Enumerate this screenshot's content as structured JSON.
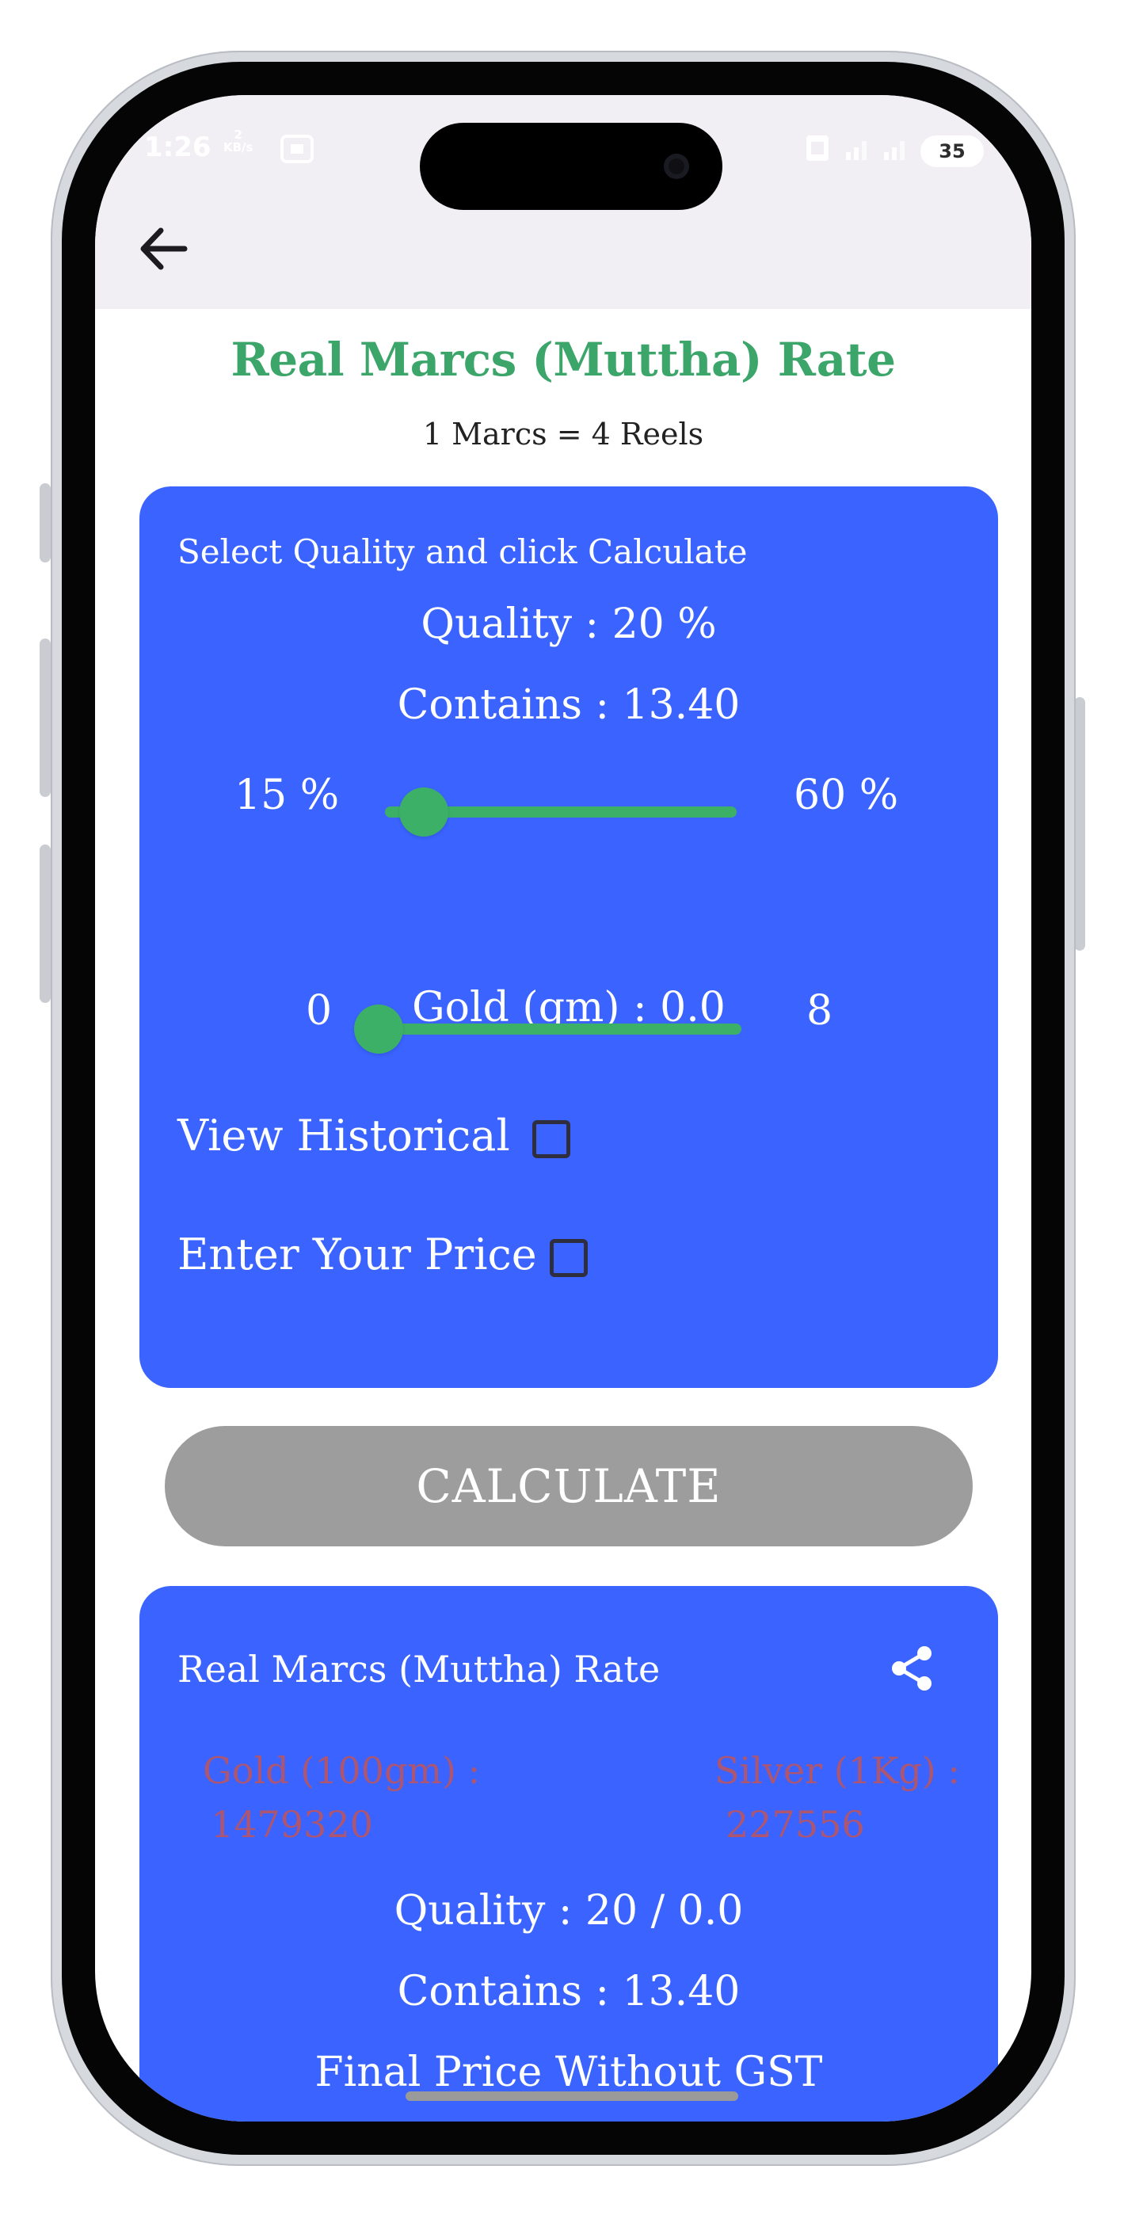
{
  "status_bar": {
    "time": "1:26",
    "net_speed_value": "2",
    "net_speed_unit": "KB/s",
    "battery": "35"
  },
  "app_bar": {
    "back_icon": "arrow-left-icon"
  },
  "header": {
    "title": "Real Marcs (Muttha) Rate",
    "subtitle": "1 Marcs = 4 Reels"
  },
  "input_card": {
    "hint": "Select Quality and click Calculate",
    "quality_text": "Quality : 20 %",
    "contains_text": "Contains : 13.40",
    "quality_slider": {
      "min_label": "15 %",
      "max_label": "60 %",
      "min": 15,
      "max": 60,
      "value": 20
    },
    "gold_text": "Gold (gm) : 0.0",
    "gold_slider": {
      "min_label": "0",
      "max_label": "8",
      "min": 0,
      "max": 8,
      "value": 0
    },
    "view_historical_label": "View Historical",
    "view_historical_checked": false,
    "enter_price_label": "Enter Your Price",
    "enter_price_checked": false
  },
  "calculate_button": {
    "label": "CALCULATE"
  },
  "result_card": {
    "title": "Real Marcs (Muttha) Rate",
    "share_icon": "share-icon",
    "gold_label": "Gold (100gm) :",
    "gold_value": "1479320",
    "silver_label": "Silver (1Kg) :",
    "silver_value": "227556",
    "quality_text": "Quality :  20 / 0.0",
    "contains_text": "Contains :  13.40",
    "final_price_text": "Final Price Without GST"
  },
  "colors": {
    "accent_green": "#3ba56a",
    "card_blue": "#3a63ff",
    "button_grey": "#9d9d9d",
    "rate_red": "#c0545a"
  }
}
